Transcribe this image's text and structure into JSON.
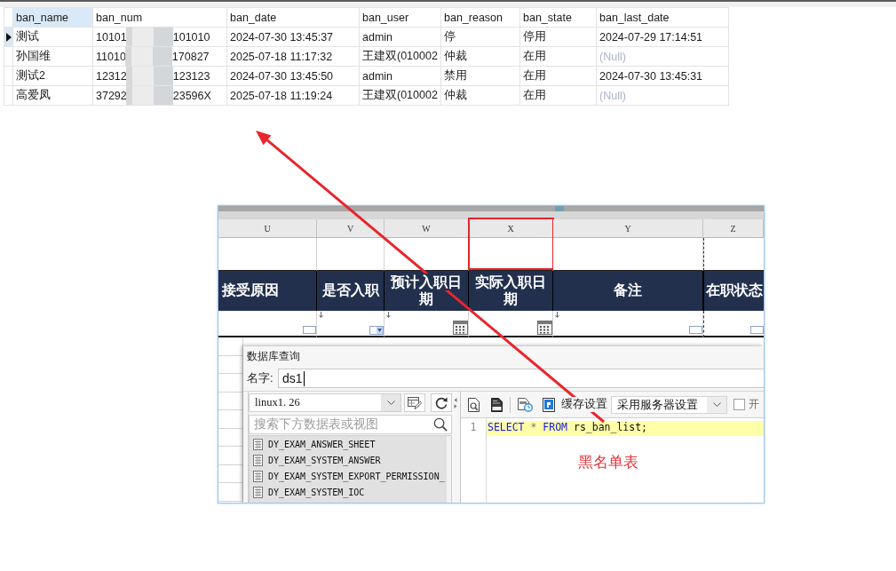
{
  "grid": {
    "columns": [
      {
        "label": "ban_name",
        "selected": true
      },
      {
        "label": "ban_num",
        "selected": false
      },
      {
        "label": "ban_date",
        "selected": false
      },
      {
        "label": "ban_user",
        "selected": false
      },
      {
        "label": "ban_reason",
        "selected": false
      },
      {
        "label": "ban_state",
        "selected": false
      },
      {
        "label": "ban_last_date",
        "selected": false
      }
    ],
    "rows": [
      {
        "selected": true,
        "cells": [
          {
            "kind": "text",
            "text": "测试"
          },
          {
            "kind": "masked",
            "start": "10101",
            "end": "101010"
          },
          {
            "kind": "text",
            "text": "2024-07-30 13:45:37"
          },
          {
            "kind": "text",
            "text": "admin"
          },
          {
            "kind": "text",
            "text": "停"
          },
          {
            "kind": "text",
            "text": "停用"
          },
          {
            "kind": "text",
            "text": "2024-07-29 17:14:51"
          }
        ]
      },
      {
        "selected": false,
        "cells": [
          {
            "kind": "text",
            "text": "孙国维"
          },
          {
            "kind": "masked",
            "start": "11010",
            "end": "170827"
          },
          {
            "kind": "text",
            "text": "2025-07-18 11:17:32"
          },
          {
            "kind": "text",
            "text": "王建双(010002"
          },
          {
            "kind": "text",
            "text": "仲裁"
          },
          {
            "kind": "text",
            "text": "在用"
          },
          {
            "kind": "null",
            "text": "(Null)"
          }
        ]
      },
      {
        "selected": false,
        "cells": [
          {
            "kind": "text",
            "text": "测试2"
          },
          {
            "kind": "masked",
            "start": "12312",
            "end": "123123"
          },
          {
            "kind": "text",
            "text": "2024-07-30 13:45:50"
          },
          {
            "kind": "text",
            "text": "admin"
          },
          {
            "kind": "text",
            "text": "禁用"
          },
          {
            "kind": "text",
            "text": "在用"
          },
          {
            "kind": "text",
            "text": "2024-07-30 13:45:31"
          }
        ]
      },
      {
        "selected": false,
        "cells": [
          {
            "kind": "text",
            "text": "高爱凤"
          },
          {
            "kind": "masked",
            "start": "37292",
            "end": "23596X"
          },
          {
            "kind": "text",
            "text": "2025-07-18 11:19:24"
          },
          {
            "kind": "text",
            "text": "王建双(010002"
          },
          {
            "kind": "text",
            "text": "仲裁"
          },
          {
            "kind": "text",
            "text": "在用"
          },
          {
            "kind": "null",
            "text": "(Null)"
          }
        ]
      }
    ]
  },
  "embedded_screenshot": {
    "sheet_columns": [
      {
        "letter": "U",
        "header": "接受原因",
        "kind": "text",
        "marker": false,
        "highlighted": false
      },
      {
        "letter": "V",
        "header": "是否入职",
        "kind": "dropdown",
        "marker": true,
        "highlighted": false
      },
      {
        "letter": "W",
        "header": "预计入职日期",
        "kind": "date",
        "marker": true,
        "highlighted": false
      },
      {
        "letter": "X",
        "header": "实际入职日期",
        "kind": "date",
        "marker": false,
        "highlighted": true
      },
      {
        "letter": "Y",
        "header": "备注",
        "kind": "text",
        "marker": true,
        "highlighted": false
      },
      {
        "letter": "Z",
        "header": "在职状态",
        "kind": "text",
        "marker": false,
        "highlighted": false
      }
    ],
    "dialog": {
      "title": "数据库查询",
      "name_label": "名字:",
      "name_value": "ds1",
      "connection": "linux1. 26",
      "search_placeholder": "搜索下方数据表或视图",
      "tables": [
        "DY_EXAM_ANSWER_SHEET",
        "DY_EXAM_SYSTEM_ANSWER",
        "DY_EXAM_SYSTEM_EXPORT_PERMISSION_",
        "DY_EXAM_SYSTEM_IOC"
      ],
      "cache_label": "缓存设置",
      "cache_value": "采用服务器设置",
      "checkbox": {
        "label": "开",
        "checked": false
      },
      "editor": {
        "lines": [
          {
            "number": "1",
            "highlighted": true,
            "tokens": [
              {
                "kind": "keyword",
                "text": "SELECT"
              },
              {
                "kind": "operator",
                "text": "*"
              },
              {
                "kind": "keyword",
                "text": "FROM"
              },
              {
                "kind": "identifier",
                "text": "rs_ban_list;"
              }
            ]
          }
        ],
        "note": "黑名单表"
      }
    }
  }
}
